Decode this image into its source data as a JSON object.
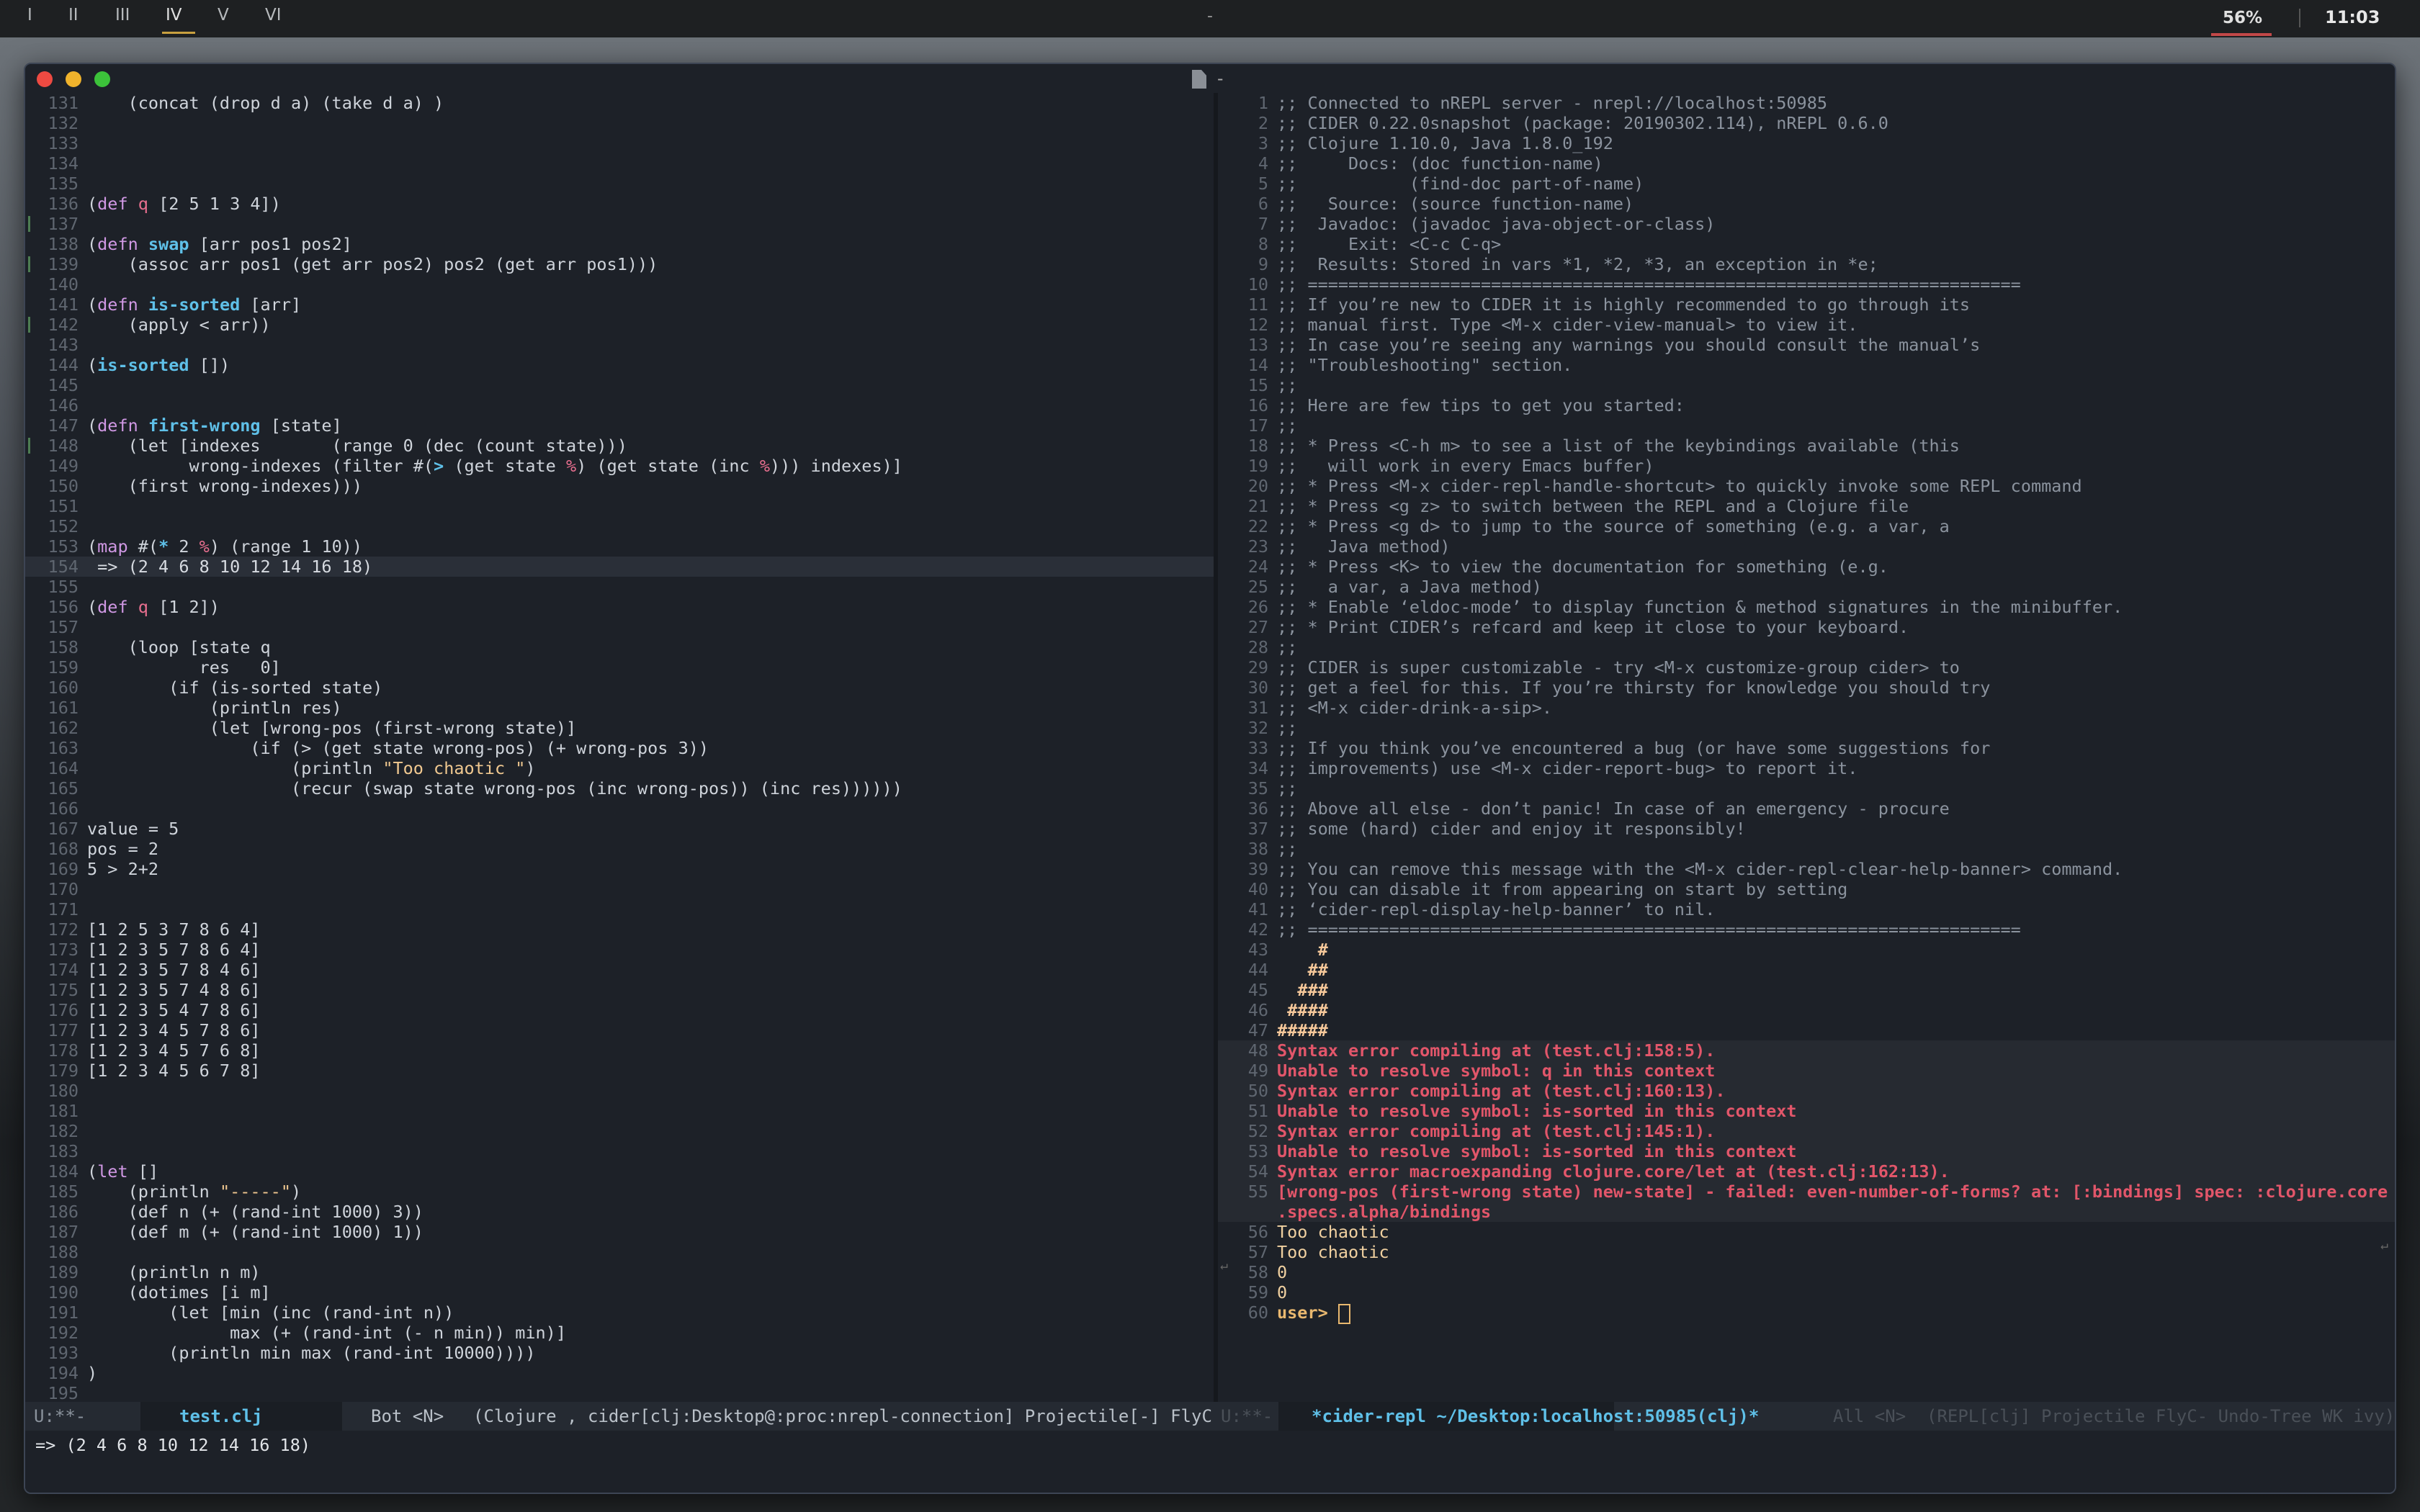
{
  "topbar": {
    "workspaces": [
      "I",
      "II",
      "III",
      "IV",
      "V",
      "VI"
    ],
    "active_workspace": "IV",
    "center": "-",
    "battery": "56%",
    "clock": "11:03"
  },
  "window": {
    "title": "-"
  },
  "editor": {
    "first_line": 131,
    "lines": [
      "    (concat (drop d a) (take d a) )",
      "",
      "",
      "",
      "",
      "(def q [2 5 1 3 4])",
      "",
      "(defn swap [arr pos1 pos2]",
      "    (assoc arr pos1 (get arr pos2) pos2 (get arr pos1)))",
      "",
      "(defn is-sorted [arr]",
      "    (apply < arr))",
      "",
      "(is-sorted [])",
      "",
      "",
      "(defn first-wrong [state]",
      "    (let [indexes       (range 0 (dec (count state)))",
      "          wrong-indexes (filter #(> (get state %) (get state (inc %))) indexes)]",
      "    (first wrong-indexes)))",
      "",
      "",
      "(map #(* 2 %) (range 1 10))",
      "",
      "",
      "(def q [1 2])",
      "",
      "    (loop [state q",
      "           res   0]",
      "        (if (is-sorted state)",
      "            (println res)",
      "            (let [wrong-pos (first-wrong state)]",
      "                (if (> (get state wrong-pos) (+ wrong-pos 3))",
      "                    (println \"Too chaotic \")",
      "                    (recur (swap state wrong-pos (inc wrong-pos)) (inc res))))))",
      "",
      "value = 5",
      "pos = 2",
      "5 > 2+2",
      "",
      "",
      "[1 2 5 3 7 8 6 4]",
      "[1 2 3 5 7 8 6 4]",
      "[1 2 3 5 7 8 4 6]",
      "[1 2 3 5 7 4 8 6]",
      "[1 2 3 5 4 7 8 6]",
      "[1 2 3 4 5 7 8 6]",
      "[1 2 3 4 5 7 6 8]",
      "[1 2 3 4 5 6 7 8]",
      "",
      "",
      "",
      "",
      "(let []",
      "    (println \"-----\")",
      "    (def n (+ (rand-int 1000) 3))",
      "    (def m (+ (rand-int 1000) 1))",
      "",
      "    (println n m)",
      "    (dotimes [i m]",
      "        (let [min (inc (rand-int n))",
      "              max (+ (rand-int (- n min)) min)]",
      "        (println min max (rand-int 10000))))",
      ")",
      ""
    ],
    "current_line": 154,
    "eval_result": "=> (2 4 6 8 10 12 14 16 18)",
    "marked_lines": [
      137,
      139,
      142,
      148
    ]
  },
  "repl": {
    "first_line": 1,
    "lines": [
      ";; Connected to nREPL server - nrepl://localhost:50985",
      ";; CIDER 0.22.0snapshot (package: 20190302.114), nREPL 0.6.0",
      ";; Clojure 1.10.0, Java 1.8.0_192",
      ";;     Docs: (doc function-name)",
      ";;           (find-doc part-of-name)",
      ";;   Source: (source function-name)",
      ";;  Javadoc: (javadoc java-object-or-class)",
      ";;     Exit: <C-c C-q>",
      ";;  Results: Stored in vars *1, *2, *3, an exception in *e;",
      ";; ======================================================================",
      ";; If you’re new to CIDER it is highly recommended to go through its",
      ";; manual first. Type <M-x cider-view-manual> to view it.",
      ";; In case you’re seeing any warnings you should consult the manual’s",
      ";; \"Troubleshooting\" section.",
      ";;",
      ";; Here are few tips to get you started:",
      ";;",
      ";; * Press <C-h m> to see a list of the keybindings available (this",
      ";;   will work in every Emacs buffer)",
      ";; * Press <M-x cider-repl-handle-shortcut> to quickly invoke some REPL command",
      ";; * Press <g z> to switch between the REPL and a Clojure file",
      ";; * Press <g d> to jump to the source of something (e.g. a var, a",
      ";;   Java method)",
      ";; * Press <K> to view the documentation for something (e.g.",
      ";;   a var, a Java method)",
      ";; * Enable ‘eldoc-mode’ to display function & method signatures in the minibuffer.",
      ";; * Print CIDER’s refcard and keep it close to your keyboard.",
      ";;",
      ";; CIDER is super customizable - try <M-x customize-group cider> to",
      ";; get a feel for this. If you’re thirsty for knowledge you should try",
      ";; <M-x cider-drink-a-sip>.",
      ";;",
      ";; If you think you’ve encountered a bug (or have some suggestions for",
      ";; improvements) use <M-x cider-report-bug> to report it.",
      ";;",
      ";; Above all else - don’t panic! In case of an emergency - procure",
      ";; some (hard) cider and enjoy it responsibly!",
      ";;",
      ";; You can remove this message with the <M-x cider-repl-clear-help-banner> command.",
      ";; You can disable it from appearing on start by setting",
      ";; ‘cider-repl-display-help-banner’ to nil.",
      ";; ======================================================================",
      "    #",
      "   ##",
      "  ###",
      " ####",
      "#####",
      "Syntax error compiling at (test.clj:158:5).",
      "Unable to resolve symbol: q in this context",
      "Syntax error compiling at (test.clj:160:13).",
      "Unable to resolve symbol: is-sorted in this context",
      "Syntax error compiling at (test.clj:145:1).",
      "Unable to resolve symbol: is-sorted in this context",
      "Syntax error macroexpanding clojure.core/let at (test.clj:162:13).",
      "[wrong-pos (first-wrong state) new-state] - failed: even-number-of-forms? at: [:bindings] spec: :clojure.core",
      ".specs.alpha/bindings",
      "Too chaotic",
      "Too chaotic",
      "0",
      "0",
      "user> "
    ],
    "line_numbers": [
      "1",
      "2",
      "3",
      "4",
      "5",
      "6",
      "7",
      "8",
      "9",
      "10",
      "11",
      "12",
      "13",
      "14",
      "15",
      "16",
      "17",
      "18",
      "19",
      "20",
      "21",
      "22",
      "23",
      "24",
      "25",
      "26",
      "27",
      "28",
      "29",
      "30",
      "31",
      "32",
      "33",
      "34",
      "35",
      "36",
      "37",
      "38",
      "39",
      "40",
      "41",
      "42",
      "43",
      "44",
      "45",
      "46",
      "47",
      "48",
      "49",
      "50",
      "51",
      "52",
      "53",
      "54",
      "55",
      "",
      "56",
      "57",
      "58",
      "59",
      "60"
    ]
  },
  "modeline": {
    "left_status": "U:**-",
    "left_buffer": "test.clj",
    "left_position": "Bot <N>",
    "left_modes": "(Clojure , cider[clj:Desktop@:proc:nrepl-connection] Projectile[-] FlyC- U",
    "right_status": "U:**-",
    "right_buffer": "*cider-repl ~/Desktop:localhost:50985(clj)*",
    "right_position": "All <N>",
    "right_modes": "(REPL[clj] Projectile FlyC- Undo-Tree WK ivy)"
  },
  "minibuffer": "=> (2 4 6 8 10 12 14 16 18)",
  "colors": {
    "editor_bg": "#1d2128",
    "keyword": "#d098e4",
    "function": "#5fc0e8",
    "symbol": "#e86f8f",
    "string": "#f0c890",
    "error": "#e2566a",
    "prompt": "#e9b86f"
  }
}
